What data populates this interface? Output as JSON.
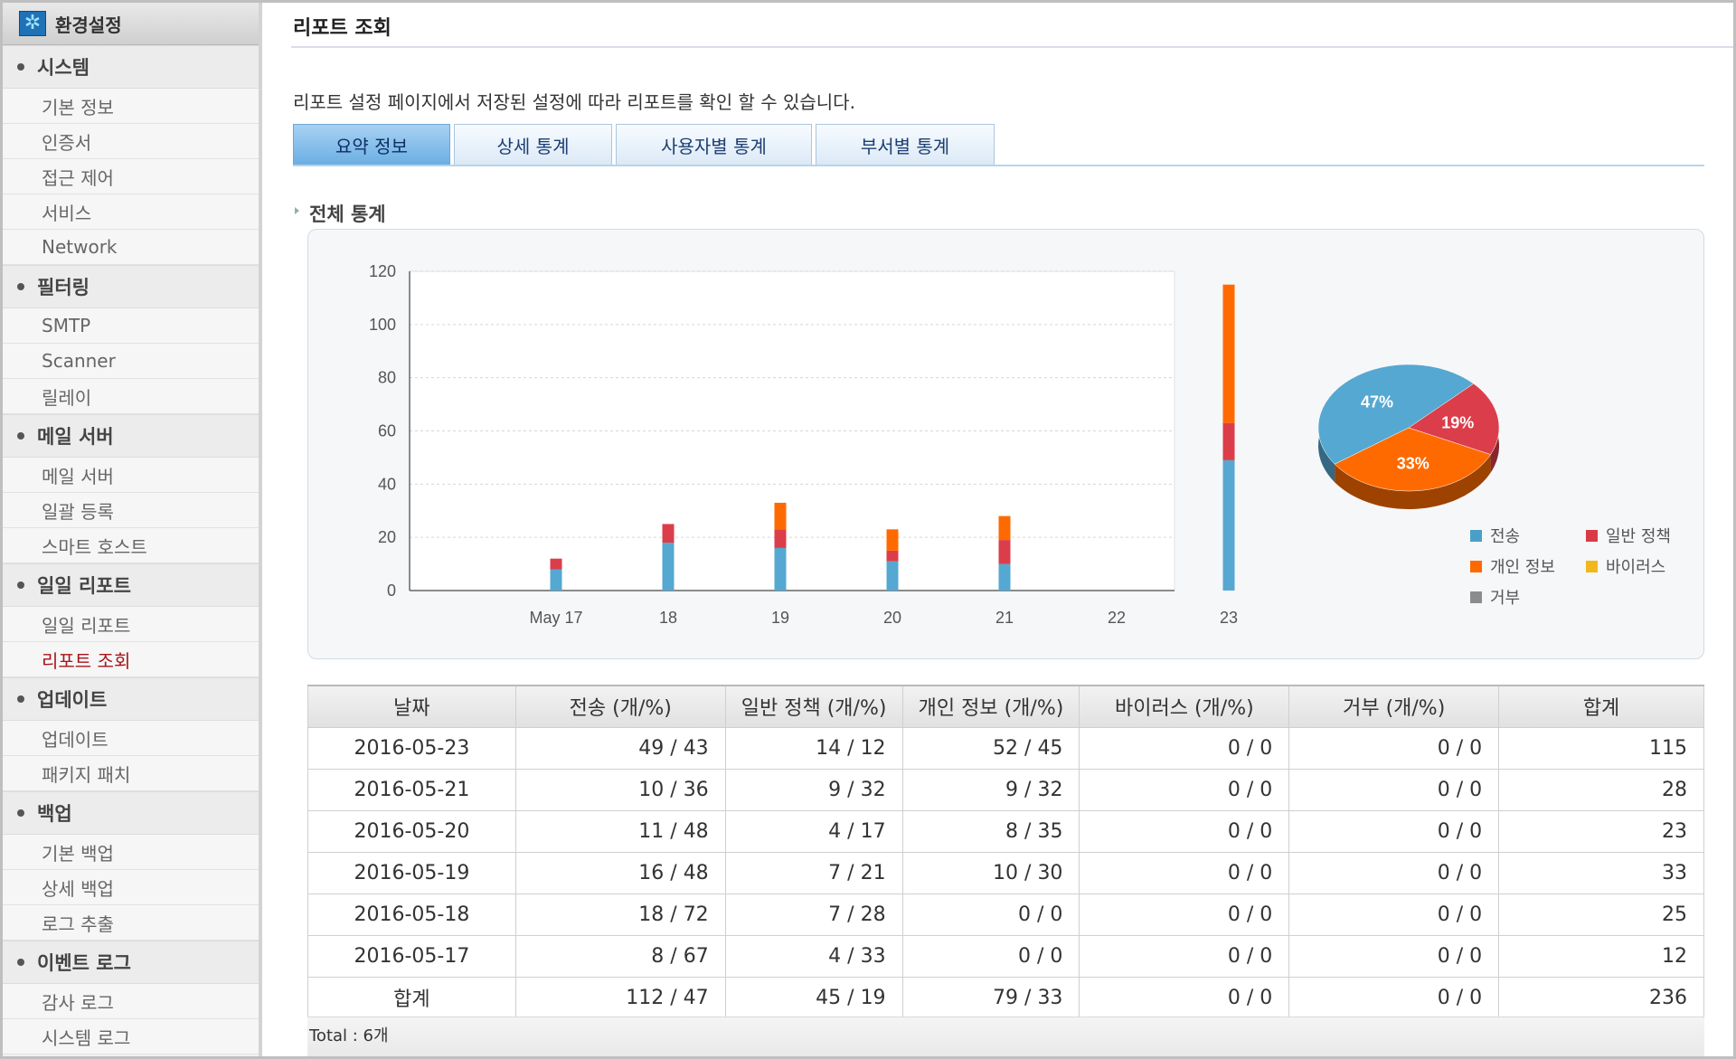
{
  "sidebar": {
    "header": "환경설정",
    "groups": [
      {
        "label": "시스템",
        "items": [
          "기본 정보",
          "인증서",
          "접근 제어",
          "서비스",
          "Network"
        ]
      },
      {
        "label": "필터링",
        "items": [
          "SMTP",
          "Scanner",
          "릴레이"
        ]
      },
      {
        "label": "메일 서버",
        "items": [
          "메일 서버",
          "일괄 등록",
          "스마트 호스트"
        ]
      },
      {
        "label": "일일 리포트",
        "items": [
          "일일 리포트",
          "리포트 조회"
        ]
      },
      {
        "label": "업데이트",
        "items": [
          "업데이트",
          "패키지 패치"
        ]
      },
      {
        "label": "백업",
        "items": [
          "기본 백업",
          "상세 백업",
          "로그 추출"
        ]
      },
      {
        "label": "이벤트 로그",
        "items": [
          "감사 로그",
          "시스템 로그"
        ]
      }
    ],
    "active_item": "리포트 조회"
  },
  "page": {
    "title": "리포트 조회",
    "description": "리포트 설정 페이지에서 저장된 설정에 따라 리포트를 확인 할 수 있습니다.",
    "tabs": [
      "요약 정보",
      "상세 통계",
      "사용자별 통계",
      "부서별 통계"
    ],
    "active_tab": "요약 정보",
    "section_title": "전체 통계"
  },
  "chart_data": [
    {
      "type": "bar",
      "stacked": true,
      "categories": [
        "May 17",
        "18",
        "19",
        "20",
        "21",
        "22",
        "23"
      ],
      "series": [
        {
          "name": "전송",
          "color": "#55a8d1",
          "values": [
            8,
            18,
            16,
            11,
            10,
            0,
            49
          ]
        },
        {
          "name": "일반 정책",
          "color": "#dc3d4a",
          "values": [
            4,
            7,
            7,
            4,
            9,
            0,
            14
          ]
        },
        {
          "name": "개인 정보",
          "color": "#ff6a00",
          "values": [
            0,
            0,
            10,
            8,
            9,
            0,
            52
          ]
        },
        {
          "name": "바이러스",
          "color": "#f2b71a",
          "values": [
            0,
            0,
            0,
            0,
            0,
            0,
            0
          ]
        },
        {
          "name": "거부",
          "color": "#8c8c8c",
          "values": [
            0,
            0,
            0,
            0,
            0,
            0,
            0
          ]
        }
      ],
      "ylim": [
        0,
        120
      ],
      "yticks": [
        0,
        20,
        40,
        60,
        80,
        100,
        120
      ],
      "grid": true
    },
    {
      "type": "pie",
      "slices": [
        {
          "name": "전송",
          "value": 47,
          "label": "47%",
          "color": "#55a8d1"
        },
        {
          "name": "일반 정책",
          "value": 19,
          "label": "19%",
          "color": "#dc3d4a"
        },
        {
          "name": "개인 정보",
          "value": 33,
          "label": "33%",
          "color": "#ff6a00"
        }
      ],
      "legend": [
        {
          "name": "전송",
          "color": "#4a9fc9"
        },
        {
          "name": "일반 정책",
          "color": "#d83b47"
        },
        {
          "name": "개인 정보",
          "color": "#ff6a00"
        },
        {
          "name": "바이러스",
          "color": "#f2b71a"
        },
        {
          "name": "거부",
          "color": "#8c8c8c"
        }
      ]
    }
  ],
  "table": {
    "headers": [
      "날짜",
      "전송 (개/%)",
      "일반 정책 (개/%)",
      "개인 정보 (개/%)",
      "바이러스 (개/%)",
      "거부 (개/%)",
      "합계"
    ],
    "rows": [
      [
        "2016-05-23",
        "49 / 43",
        "14 / 12",
        "52 / 45",
        "0 / 0",
        "0 / 0",
        "115"
      ],
      [
        "2016-05-21",
        "10 / 36",
        "9 / 32",
        "9 / 32",
        "0 / 0",
        "0 / 0",
        "28"
      ],
      [
        "2016-05-20",
        "11 / 48",
        "4 / 17",
        "8 / 35",
        "0 / 0",
        "0 / 0",
        "23"
      ],
      [
        "2016-05-19",
        "16 / 48",
        "7 / 21",
        "10 / 30",
        "0 / 0",
        "0 / 0",
        "33"
      ],
      [
        "2016-05-18",
        "18 / 72",
        "7 / 28",
        "0 / 0",
        "0 / 0",
        "0 / 0",
        "25"
      ],
      [
        "2016-05-17",
        "8 / 67",
        "4 / 33",
        "0 / 0",
        "0 / 0",
        "0 / 0",
        "12"
      ],
      [
        "합계",
        "112 / 47",
        "45 / 19",
        "79 / 33",
        "0 / 0",
        "0 / 0",
        "236"
      ]
    ],
    "total_label": "Total : 6개"
  }
}
